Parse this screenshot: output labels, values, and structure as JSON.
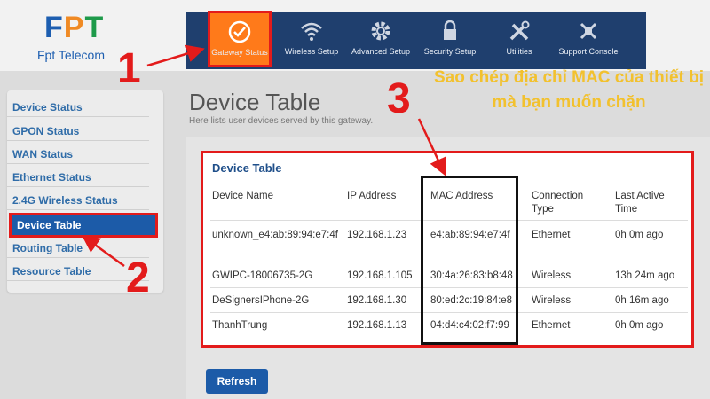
{
  "brand": {
    "letters": [
      "F",
      "P",
      "T"
    ],
    "subtitle": "Fpt Telecom"
  },
  "nav": {
    "items": [
      {
        "label": "Gateway Status",
        "icon": "check-circle-icon"
      },
      {
        "label": "Wireless Setup",
        "icon": "wifi-icon"
      },
      {
        "label": "Advanced Setup",
        "icon": "gear-icon"
      },
      {
        "label": "Security Setup",
        "icon": "lock-icon"
      },
      {
        "label": "Utilities",
        "icon": "tools-icon"
      },
      {
        "label": "Support Console",
        "icon": "support-icon"
      }
    ]
  },
  "sidebar": {
    "items": [
      {
        "label": "Device Status"
      },
      {
        "label": "GPON Status"
      },
      {
        "label": "WAN Status"
      },
      {
        "label": "Ethernet Status"
      },
      {
        "label": "2.4G Wireless Status"
      },
      {
        "label": "Device Table"
      },
      {
        "label": "Routing Table"
      },
      {
        "label": "Resource Table"
      }
    ]
  },
  "main": {
    "title": "Device Table",
    "subtitle": "Here lists user devices served by this gateway.",
    "refresh_label": "Refresh"
  },
  "table": {
    "title": "Device Table",
    "headers": [
      "Device Name",
      "IP Address",
      "MAC Address",
      "Connection Type",
      "Last Active Time"
    ],
    "rows": [
      [
        "unknown_e4:ab:89:94:e7:4f",
        "192.168.1.23",
        "e4:ab:89:94:e7:4f",
        "Ethernet",
        "0h 0m ago"
      ],
      [
        "GWIPC-18006735-2G",
        "192.168.1.105",
        "30:4a:26:83:b8:48",
        "Wireless",
        "13h 24m ago"
      ],
      [
        "DeSignersIPhone-2G",
        "192.168.1.30",
        "80:ed:2c:19:84:e8",
        "Wireless",
        "0h 16m ago"
      ],
      [
        "ThanhTrung",
        "192.168.1.13",
        "04:d4:c4:02:f7:99",
        "Ethernet",
        "0h 0m ago"
      ]
    ]
  },
  "annotation": {
    "text": "Sao chép địa chỉ MAC của thiết bị mà bạn muốn chặn",
    "step1": "1",
    "step2": "2",
    "step3": "3"
  },
  "colors": {
    "accent_red": "#e31b1b",
    "nav_bg": "#1f3f6e",
    "active_orange": "#ff7a1a",
    "note_yellow": "#f2c12e"
  }
}
